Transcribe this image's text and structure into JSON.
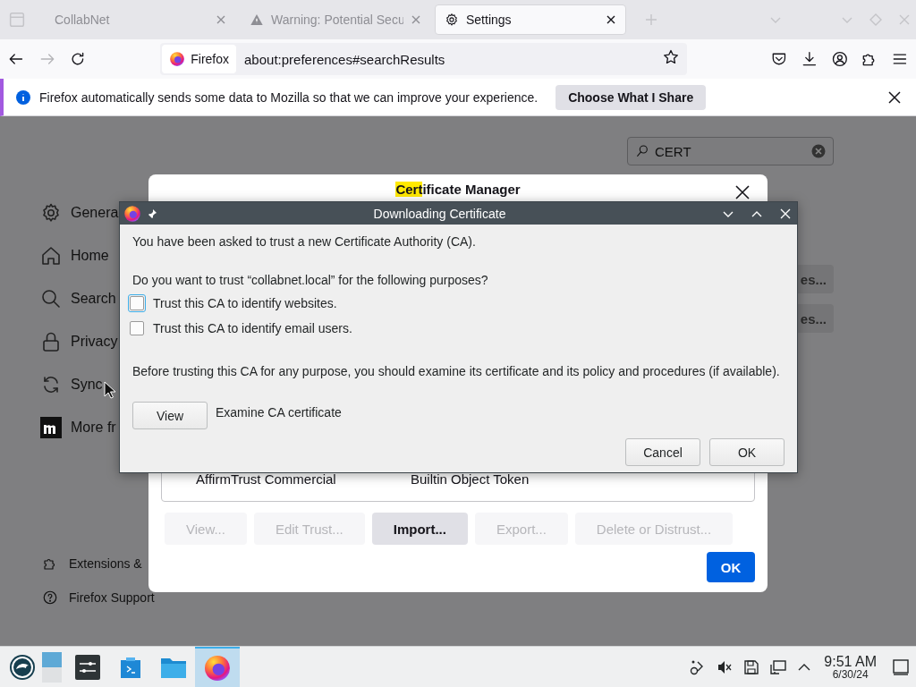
{
  "browser_tabs": [
    {
      "title": "CollabNet",
      "selected": false
    },
    {
      "title": "Warning: Potential Secu",
      "selected": false
    },
    {
      "title": "Settings",
      "selected": true
    }
  ],
  "forward_button": {
    "disabled": true
  },
  "address_bar": {
    "identity": "Firefox",
    "url": "about:preferences#searchResults"
  },
  "notification": {
    "message": "Firefox automatically sends some data to Mozilla so that we can improve your experience.",
    "button": "Choose What I Share"
  },
  "settings_search": {
    "value": "CERT"
  },
  "sidebar": {
    "items": [
      {
        "label": "Genera"
      },
      {
        "label": "Home"
      },
      {
        "label": "Search"
      },
      {
        "label": "Privacy"
      },
      {
        "label": "Sync"
      },
      {
        "label": "More fr"
      }
    ],
    "footer": [
      {
        "label": "Extensions &"
      },
      {
        "label": "Firefox Support"
      }
    ]
  },
  "partly_hidden_buttons": [
    "es...",
    "es..."
  ],
  "certificate_manager": {
    "title_parts": [
      {
        "text": "Cert",
        "highlighted": true
      },
      {
        "text": "ificate Manager",
        "highlighted": false
      }
    ],
    "rows": [
      {
        "name": "AffirmTrust Commercial",
        "device": "Builtin Object Token"
      }
    ],
    "buttons": [
      {
        "label": "View...",
        "disabled": true
      },
      {
        "label": "Edit Trust...",
        "disabled": true
      },
      {
        "label": "Import...",
        "disabled": false
      },
      {
        "label": "Export...",
        "disabled": true
      },
      {
        "label": "Delete or Distrust...",
        "disabled": true
      }
    ],
    "ok": "OK"
  },
  "download_dialog": {
    "title": "Downloading Certificate",
    "intro": "You have been asked to trust a new Certificate Authority (CA).",
    "question": "Do you want to trust “collabnet.local” for the following purposes?",
    "options": [
      {
        "label": "Trust this CA to identify websites.",
        "checked": false,
        "focused": true
      },
      {
        "label": "Trust this CA to identify email users.",
        "checked": false,
        "focused": false
      }
    ],
    "warning": "Before trusting this CA for any purpose, you should examine its certificate and its policy and procedures (if available).",
    "view_button": "View",
    "view_caption": "Examine CA certificate",
    "buttons": [
      "Cancel",
      "OK"
    ]
  },
  "taskbar": {
    "time": "9:51 AM",
    "date": "6/30/24"
  }
}
